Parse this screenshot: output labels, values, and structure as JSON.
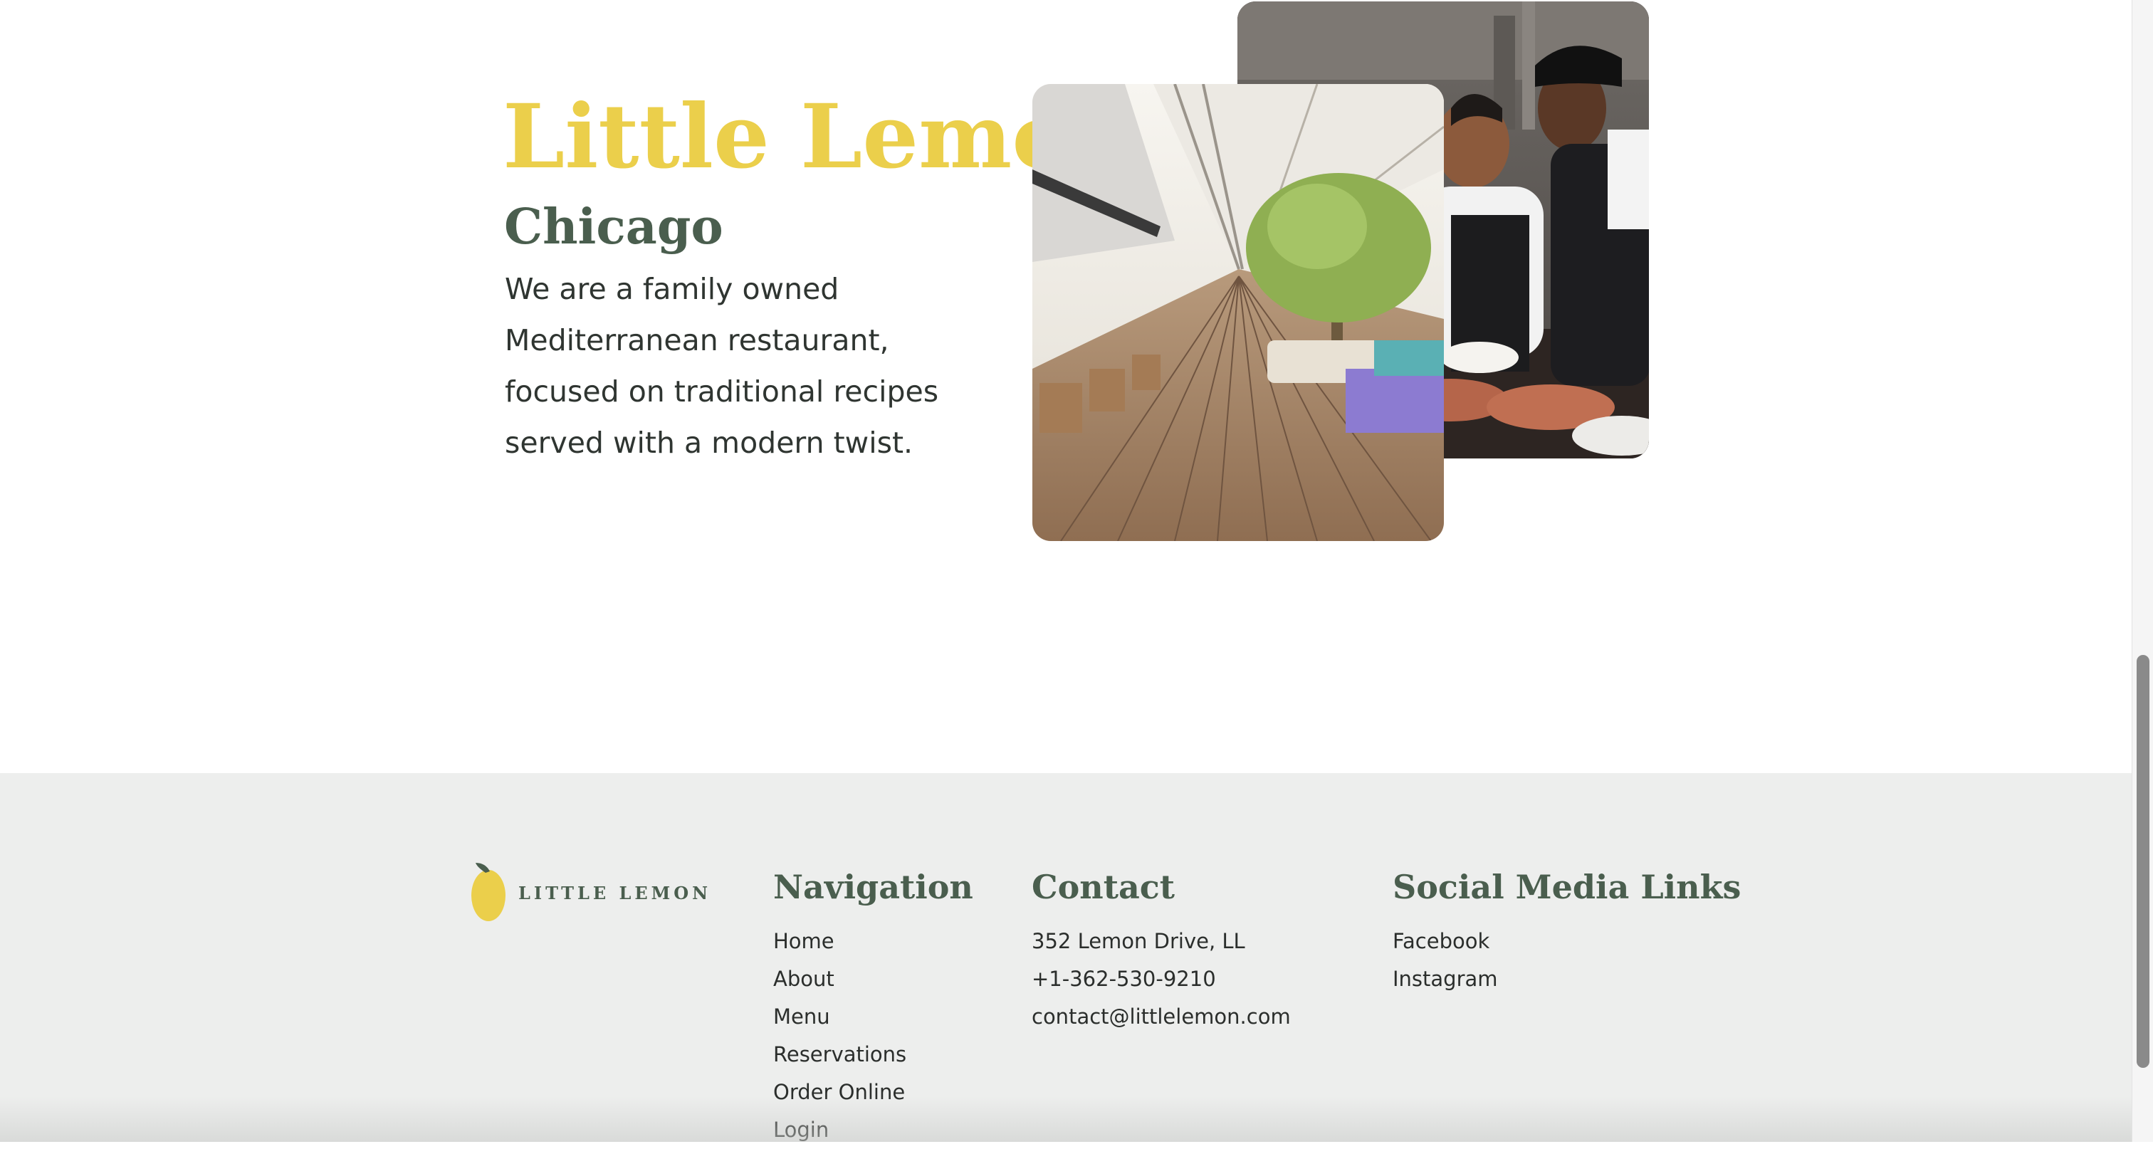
{
  "about": {
    "title": "Little Lemon",
    "subtitle": "Chicago",
    "description": "We are a family owned Mediterranean restaurant, focused on traditional recipes served with a modern twist.",
    "images": [
      "chefs-image",
      "restaurant-interior-image"
    ]
  },
  "footer": {
    "logo_text": "LITTLE LEMON",
    "navigation": {
      "heading": "Navigation",
      "links": [
        "Home",
        "About",
        "Menu",
        "Reservations",
        "Order Online",
        "Login"
      ]
    },
    "contact": {
      "heading": "Contact",
      "address": "352 Lemon Drive, LL",
      "phone": "+1-362-530-9210",
      "email": "contact@littlelemon.com"
    },
    "social": {
      "heading": "Social Media Links",
      "links": [
        "Facebook",
        "Instagram"
      ]
    }
  },
  "colors": {
    "primary_yellow": "#EBCF4B",
    "primary_green": "#4A5E4E",
    "footer_bg": "#EDEEED"
  }
}
